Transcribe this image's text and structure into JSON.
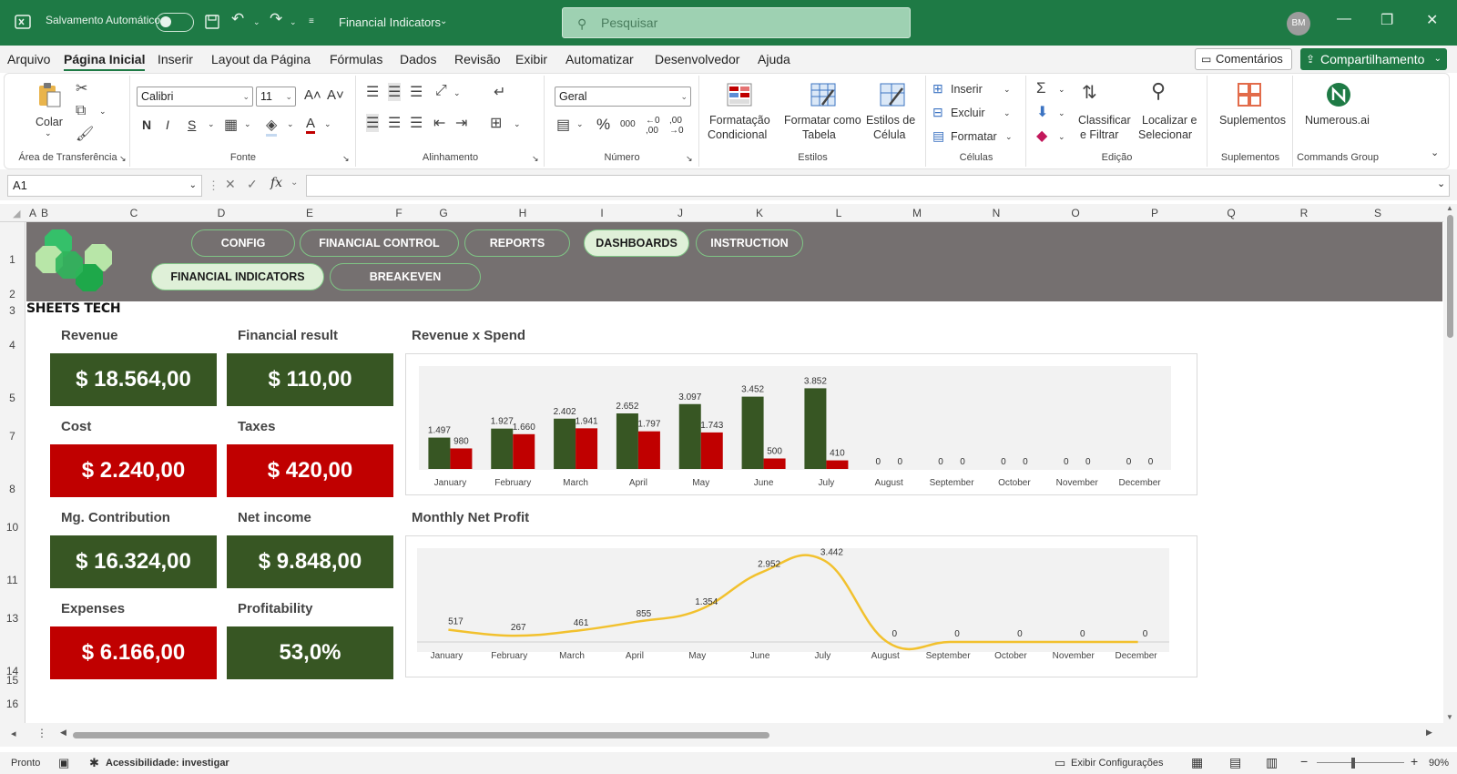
{
  "titlebar": {
    "autosave": "Salvamento Automático",
    "doc_title": "Financial Indicators",
    "search_placeholder": "Pesquisar",
    "avatar": "BM"
  },
  "menu": {
    "items": [
      "Arquivo",
      "Página Inicial",
      "Inserir",
      "Layout da Página",
      "Fórmulas",
      "Dados",
      "Revisão",
      "Exibir",
      "Automatizar",
      "Desenvolvedor",
      "Ajuda"
    ],
    "active": "Página Inicial",
    "comments": "Comentários",
    "share": "Compartilhamento"
  },
  "ribbon": {
    "paste": "Colar",
    "clipboard_label": "Área de Transferência",
    "font_name": "Calibri",
    "font_size": "11",
    "font_label": "Fonte",
    "align_label": "Alinhamento",
    "number_format": "Geral",
    "number_label": "Número",
    "cond_format_1": "Formatação",
    "cond_format_2": "Condicional",
    "table_format_1": "Formatar como",
    "table_format_2": "Tabela",
    "cell_styles_1": "Estilos de",
    "cell_styles_2": "Célula",
    "styles_label": "Estilos",
    "insert": "Inserir",
    "delete": "Excluir",
    "format": "Formatar",
    "cells_label": "Células",
    "sort_1": "Classificar",
    "sort_2": "e Filtrar",
    "find_1": "Localizar e",
    "find_2": "Selecionar",
    "edit_label": "Edição",
    "addins": "Suplementos",
    "addins_label": "Suplementos",
    "numerous": "Numerous.ai",
    "commands_label": "Commands Group"
  },
  "formula_bar": {
    "name_box": "A1",
    "formula": ""
  },
  "columns": [
    "A",
    "B",
    "C",
    "D",
    "E",
    "F",
    "G",
    "H",
    "I",
    "J",
    "K",
    "L",
    "M",
    "N",
    "O",
    "P",
    "Q",
    "R",
    "S"
  ],
  "rows": [
    "1",
    "2",
    "3",
    "4",
    "5",
    "7",
    "8",
    "10",
    "11",
    "13",
    "14",
    "15",
    "16"
  ],
  "nav": {
    "top": [
      "CONFIG",
      "FINANCIAL CONTROL",
      "REPORTS",
      "DASHBOARDS",
      "INSTRUCTION"
    ],
    "bottom": [
      "FINANCIAL INDICATORS",
      "BREAKEVEN"
    ],
    "active_top": "DASHBOARDS",
    "active_bottom": "FINANCIAL INDICATORS"
  },
  "brand": "SHEETS TECH",
  "kpis": [
    {
      "label": "Revenue",
      "value": "$ 18.564,00",
      "color": "green"
    },
    {
      "label": "Financial result",
      "value": "$ 110,00",
      "color": "green"
    },
    {
      "label": "Cost",
      "value": "$ 2.240,00",
      "color": "red"
    },
    {
      "label": "Taxes",
      "value": "$ 420,00",
      "color": "red"
    },
    {
      "label": "Mg. Contribution",
      "value": "$ 16.324,00",
      "color": "green"
    },
    {
      "label": "Net income",
      "value": "$ 9.848,00",
      "color": "green"
    },
    {
      "label": "Expenses",
      "value": "$ 6.166,00",
      "color": "red"
    },
    {
      "label": "Profitability",
      "value": "53,0%",
      "color": "green"
    }
  ],
  "colors": {
    "green": "#375623",
    "red": "#c00000",
    "line": "#f2c12e",
    "excel": "#1e7a45"
  },
  "chart_data": [
    {
      "type": "bar",
      "title": "Revenue x Spend",
      "categories": [
        "January",
        "February",
        "March",
        "April",
        "May",
        "June",
        "July",
        "August",
        "September",
        "October",
        "November",
        "December"
      ],
      "series": [
        {
          "values": [
            1497,
            1927,
            2402,
            2652,
            3097,
            3452,
            3852,
            0,
            0,
            0,
            0,
            0
          ],
          "color": "#375623"
        },
        {
          "values": [
            980,
            1660,
            1941,
            1797,
            1743,
            500,
            410,
            0,
            0,
            0,
            0,
            0
          ],
          "color": "#c00000"
        }
      ],
      "labels_a": [
        "1.497",
        "1.927",
        "2.402",
        "2.652",
        "3.097",
        "3.452",
        "3.852",
        "0",
        "0",
        "0",
        "0",
        "0"
      ],
      "labels_b": [
        "980",
        "1.660",
        "1.941",
        "1.797",
        "1.743",
        "500",
        "410",
        "0",
        "0",
        "0",
        "0",
        "0"
      ],
      "ylim": [
        0,
        4000
      ],
      "grid": false,
      "legend": "none"
    },
    {
      "type": "line",
      "title": "Monthly Net Profit",
      "categories": [
        "January",
        "February",
        "March",
        "April",
        "May",
        "June",
        "July",
        "August",
        "September",
        "October",
        "November",
        "December"
      ],
      "values": [
        517,
        267,
        461,
        855,
        1354,
        2952,
        3442,
        0,
        0,
        0,
        0,
        0
      ],
      "labels": [
        "517",
        "267",
        "461",
        "855",
        "1.354",
        "2.952",
        "3.442",
        "0",
        "0",
        "0",
        "0",
        "0"
      ],
      "ylim": [
        0,
        3700
      ],
      "smooth": true,
      "grid": false,
      "legend": "none"
    }
  ],
  "status": {
    "ready": "Pronto",
    "accessibility": "Acessibilidade: investigar",
    "display_settings": "Exibir Configurações",
    "zoom": "90%"
  }
}
